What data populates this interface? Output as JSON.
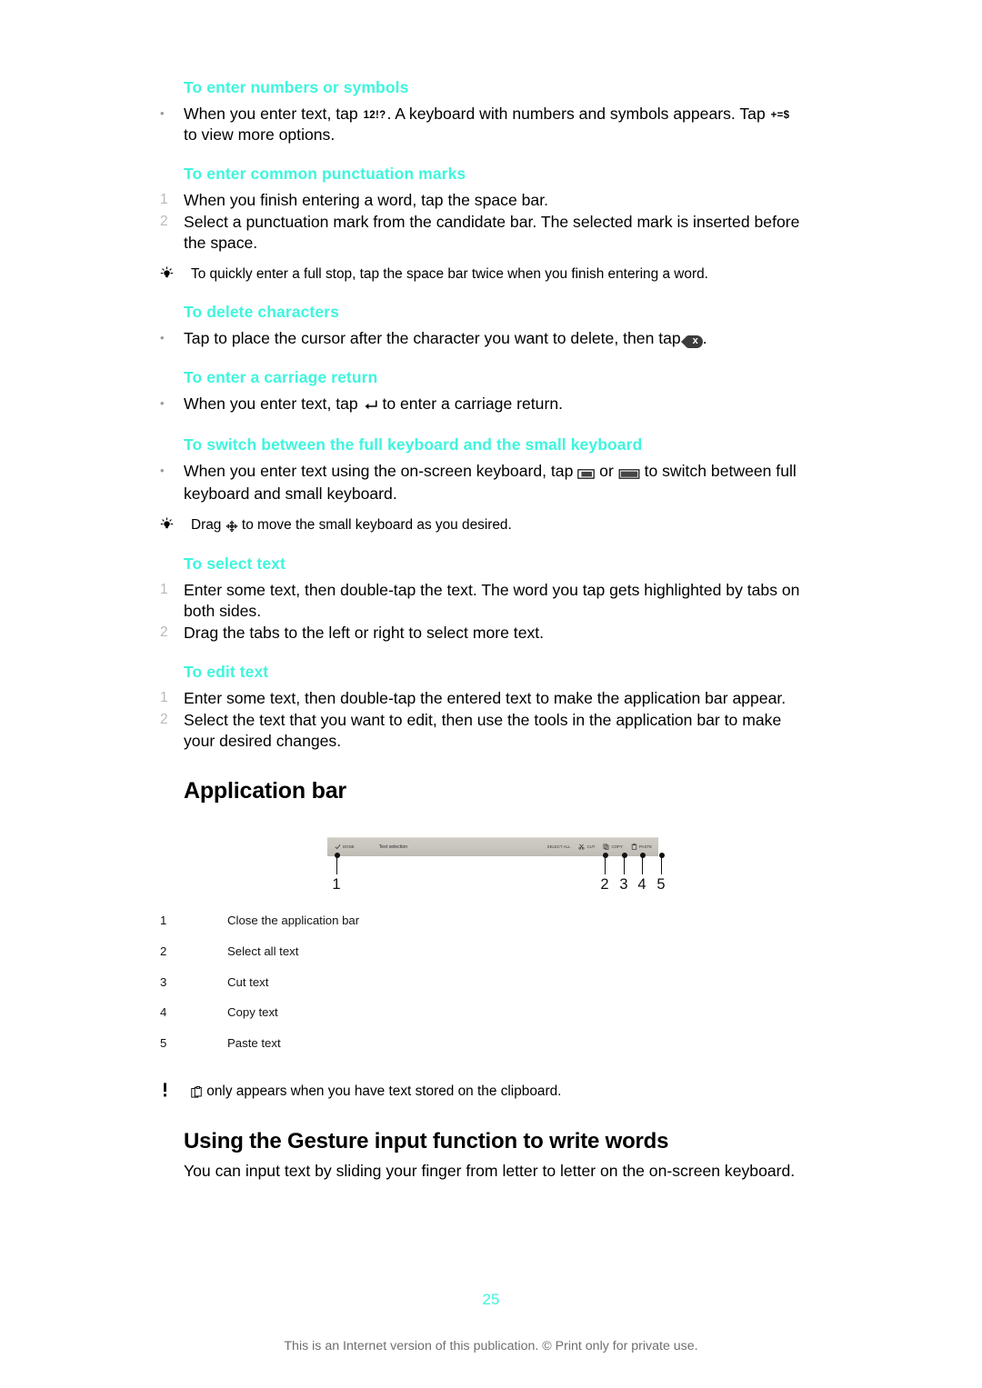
{
  "page": {
    "number": "25",
    "footer_note": "This is an Internet version of this publication. © Print only for private use.",
    "accent_color": "#3ff5dd"
  },
  "sections": [
    {
      "id": "numbers-symbols",
      "heading": "To enter numbers or symbols",
      "items": [
        {
          "marker": "•",
          "text_parts": [
            "When you enter text, tap ",
            "12!?",
            ". A keyboard with numbers and symbols appears. Tap ",
            "+=$",
            " to view more options."
          ]
        }
      ]
    },
    {
      "id": "punctuation",
      "heading": "To enter common punctuation marks",
      "items": [
        {
          "marker": "1",
          "text": "When you finish entering a word, tap the space bar."
        },
        {
          "marker": "2",
          "text": "Select a punctuation mark from the candidate bar. The selected mark is inserted before the space."
        }
      ],
      "tip": {
        "icon": "lightbulb-icon",
        "text": "To quickly enter a full stop, tap the space bar twice when you finish entering a word."
      }
    },
    {
      "id": "delete-characters",
      "heading": "To delete characters",
      "items": [
        {
          "marker": "•",
          "before": "Tap to place the cursor after the character you want to delete, then tap ",
          "icon": "backspace-delete-icon",
          "icon_label": "x",
          "after": "."
        }
      ]
    },
    {
      "id": "carriage-return",
      "heading": "To enter a carriage return",
      "items": [
        {
          "marker": "•",
          "before": "When you enter text, tap ",
          "icon": "enter-return-icon",
          "after": " to enter a carriage return."
        }
      ]
    },
    {
      "id": "switch-keyboard",
      "heading": "To switch between the full keyboard and the small keyboard",
      "items": [
        {
          "marker": "•",
          "before": "When you enter text using the on-screen keyboard, tap ",
          "icon1": "small-keyboard-icon",
          "middle": " or ",
          "icon2": "full-keyboard-icon",
          "after": " to switch between full keyboard and small keyboard."
        }
      ],
      "tip": {
        "icon": "lightbulb-icon",
        "before": "Drag ",
        "tip_icon": "move-handle-icon",
        "after": " to move the small keyboard as you desired."
      }
    },
    {
      "id": "select-text",
      "heading": "To select text",
      "items": [
        {
          "marker": "1",
          "text": "Enter some text, then double-tap the text. The word you tap gets highlighted by tabs on both sides."
        },
        {
          "marker": "2",
          "text": "Drag the tabs to the left or right to select more text."
        }
      ]
    },
    {
      "id": "edit-text",
      "heading": "To edit text",
      "items": [
        {
          "marker": "1",
          "text": "Enter some text, then double-tap the entered text to make the application bar appear."
        },
        {
          "marker": "2",
          "text": "Select the text that you want to edit, then use the tools in the application bar to make your desired changes."
        }
      ]
    }
  ],
  "application_bar": {
    "title": "Application bar",
    "figure": {
      "bar_left_done_label": "DONE",
      "bar_title": "Text selection",
      "bar_actions": [
        {
          "label": "SELECT ALL",
          "icon": "select-all-icon"
        },
        {
          "label": "CUT",
          "icon": "scissors-cut-icon"
        },
        {
          "label": "COPY",
          "icon": "copy-icon"
        },
        {
          "label": "PASTE",
          "icon": "paste-icon"
        }
      ],
      "callouts": [
        "1",
        "2",
        "3",
        "4",
        "5"
      ]
    },
    "legend": [
      {
        "num": "1",
        "label": "Close the application bar"
      },
      {
        "num": "2",
        "label": "Select all text"
      },
      {
        "num": "3",
        "label": "Cut text"
      },
      {
        "num": "4",
        "label": "Copy text"
      },
      {
        "num": "5",
        "label": "Paste text"
      }
    ],
    "note": {
      "icon": "exclamation-icon",
      "inline_icon": "paste-clipboard-icon",
      "text": " only appears when you have text stored on the clipboard."
    }
  },
  "gesture_section": {
    "heading": "Using the Gesture input function to write words",
    "paragraph": "You can input text by sliding your finger from letter to letter on the on-screen keyboard."
  }
}
